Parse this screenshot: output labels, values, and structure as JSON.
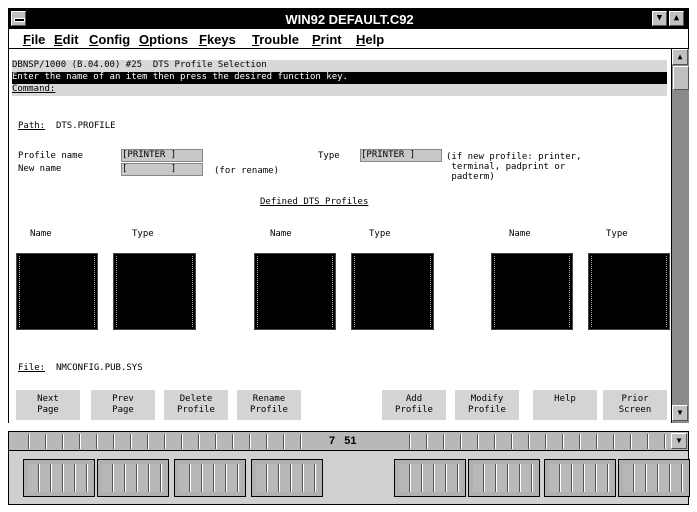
{
  "window": {
    "title": "WIN92 DEFAULT.C92",
    "sysmenu_icon": "system-menu-bar",
    "min_icon": "▼",
    "max_icon": "▲"
  },
  "menubar": {
    "items": [
      {
        "first": "F",
        "rest": "ile"
      },
      {
        "first": "E",
        "rest": "dit"
      },
      {
        "first": "C",
        "rest": "onfig"
      },
      {
        "first": "O",
        "rest": "ptions"
      },
      {
        "first": "F",
        "rest": "keys"
      },
      {
        "first": "T",
        "rest": "rouble"
      },
      {
        "first": "P",
        "rest": "rint"
      },
      {
        "first": "H",
        "rest": "elp"
      }
    ]
  },
  "terminal": {
    "header_line": "DBNSP/1000 (B.04.00) #25  DTS Profile Selection",
    "instruction": "Enter the name of an item then press the desired function key.",
    "command_label": "Command:",
    "path_label": "Path:",
    "path_value": "DTS.PROFILE",
    "profile_name_label": "Profile name",
    "profile_name_value": "[PRINTER ]",
    "new_name_label": "New name",
    "new_name_value": "[        ]",
    "for_rename": "(for rename)",
    "type_label": "Type",
    "type_value": "[PRINTER ]",
    "type_hint": "(if new profile: printer,\n terminal, padprint or\n padterm)",
    "defined_title": "Defined DTS Profiles",
    "col_headers": [
      "Name",
      "Type",
      "Name",
      "Type",
      "Name",
      "Type"
    ],
    "file_label": "File:",
    "file_value": "NMCONFIG.PUB.SYS",
    "fkeys": [
      {
        "l1": "Next",
        "l2": "Page"
      },
      {
        "l1": "Prev",
        "l2": "Page"
      },
      {
        "l1": "Delete",
        "l2": "Profile"
      },
      {
        "l1": "Rename",
        "l2": "Profile"
      },
      {
        "l1": "Add",
        "l2": "Profile"
      },
      {
        "l1": "Modify",
        "l2": "Profile"
      },
      {
        "l1": "Help",
        "l2": ""
      },
      {
        "l1": "Prior",
        "l2": "Screen"
      }
    ]
  },
  "scrollbar": {
    "up": "▲",
    "down": "▼"
  },
  "statusbar": {
    "row": "7",
    "col": "51",
    "dropdown_icon": "▼"
  }
}
